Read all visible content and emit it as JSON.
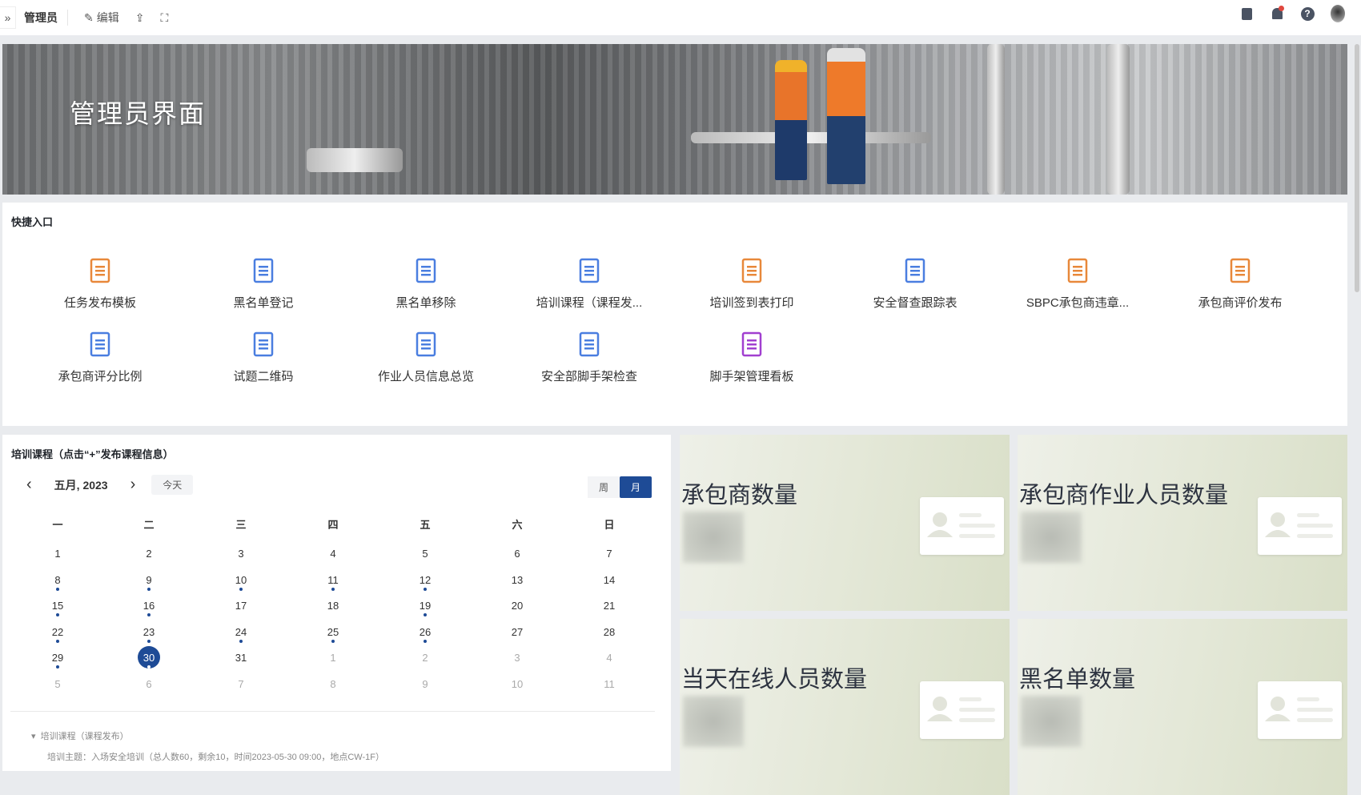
{
  "topbar": {
    "title": "管理员",
    "edit": "编辑"
  },
  "banner": {
    "title": "管理员界面"
  },
  "quick": {
    "title": "快捷入口",
    "items": [
      {
        "label": "任务发布模板",
        "color": "#e8883a"
      },
      {
        "label": "黑名单登记",
        "color": "#4a7ee0"
      },
      {
        "label": "黑名单移除",
        "color": "#4a7ee0"
      },
      {
        "label": "培训课程（课程发...",
        "color": "#4a7ee0"
      },
      {
        "label": "培训签到表打印",
        "color": "#e8883a"
      },
      {
        "label": "安全督查跟踪表",
        "color": "#4a7ee0"
      },
      {
        "label": "SBPC承包商违章...",
        "color": "#e8883a"
      },
      {
        "label": "承包商评价发布",
        "color": "#e8883a"
      },
      {
        "label": "承包商评分比例",
        "color": "#4a7ee0"
      },
      {
        "label": "试题二维码",
        "color": "#4a7ee0"
      },
      {
        "label": "作业人员信息总览",
        "color": "#4a7ee0"
      },
      {
        "label": "安全部脚手架检查",
        "color": "#4a7ee0"
      },
      {
        "label": "脚手架管理看板",
        "color": "#a13fd0"
      }
    ]
  },
  "calendar": {
    "title": "培训课程（点击“+”发布课程信息）",
    "month": "五月, 2023",
    "today": "今天",
    "week": "周",
    "monthView": "月",
    "weekdays": [
      "一",
      "二",
      "三",
      "四",
      "五",
      "六",
      "日"
    ],
    "days": [
      [
        "1",
        "2",
        "3",
        "4",
        "5",
        "6",
        "7"
      ],
      [
        "8",
        "9",
        "10",
        "11",
        "12",
        "13",
        "14"
      ],
      [
        "15",
        "16",
        "17",
        "18",
        "19",
        "20",
        "21"
      ],
      [
        "22",
        "23",
        "24",
        "25",
        "26",
        "27",
        "28"
      ],
      [
        "29",
        "30",
        "31",
        "1",
        "2",
        "3",
        "4"
      ],
      [
        "5",
        "6",
        "7",
        "8",
        "9",
        "10",
        "11"
      ]
    ],
    "event_days": [
      8,
      9,
      10,
      11,
      12,
      15,
      16,
      19,
      22,
      23,
      24,
      25,
      26,
      29,
      30
    ],
    "selected": "30",
    "section": "培训课程（课程发布）",
    "detail": "培训主题：入场安全培训（总人数60，剩余10，时间2023-05-30 09:00，地点CW-1F）"
  },
  "stats": [
    {
      "label": "承包商数量"
    },
    {
      "label": "承包商作业人员数量"
    },
    {
      "label": "当天在线人员数量"
    },
    {
      "label": "黑名单数量"
    }
  ],
  "colors": {
    "accent": "#1e4b96",
    "orange": "#e8883a",
    "blue": "#4a7ee0"
  }
}
